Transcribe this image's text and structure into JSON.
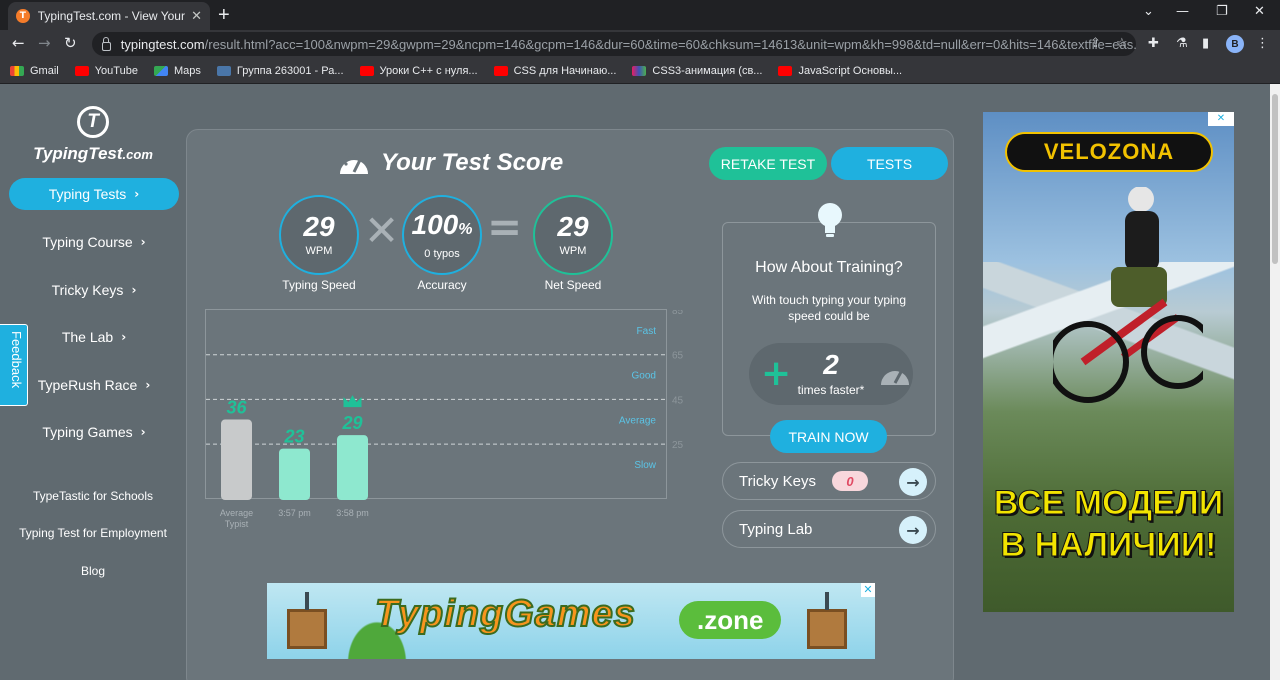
{
  "browser": {
    "tab_title": "TypingTest.com - View Your Typing Test Result",
    "url_host": "typingtest.com",
    "url_path": "/result.html?acc=100&nwpm=29&gwpm=29&ncpm=146&gcpm=146&dur=60&time=60&chksum=14613&unit=wpm&kh=998&td=null&err=0&hits=146&textfile=eas...",
    "profile_initial": "B",
    "bookmarks": [
      {
        "label": "Gmail",
        "icon": "gmail-icon"
      },
      {
        "label": "YouTube",
        "icon": "youtube-icon"
      },
      {
        "label": "Maps",
        "icon": "maps-icon"
      },
      {
        "label": "Группа 263001 - Ра...",
        "icon": "vk-icon"
      },
      {
        "label": "Уроки С++ с нуля...",
        "icon": "youtube-icon"
      },
      {
        "label": "CSS для Начинаю...",
        "icon": "youtube-icon"
      },
      {
        "label": "CSS3-анимация (св...",
        "icon": "css-icon"
      },
      {
        "label": "JavaScript Основы...",
        "icon": "youtube-icon"
      }
    ]
  },
  "sidebar": {
    "logo_text": "TypingTest",
    "logo_suffix": ".com",
    "logo_letter": "T",
    "nav": [
      {
        "label": "Typing Tests",
        "active": true
      },
      {
        "label": "Typing Course"
      },
      {
        "label": "Tricky Keys"
      },
      {
        "label": "The Lab"
      },
      {
        "label": "TypeRush Race"
      },
      {
        "label": "Typing Games"
      }
    ],
    "links": [
      "TypeTastic for Schools",
      "Typing Test for Employment",
      "Blog"
    ],
    "feedback": "Feedback"
  },
  "result": {
    "title": "Your Test Score",
    "retake_label": "RETAKE TEST",
    "tests_label": "TESTS",
    "typing_speed": {
      "value": "29",
      "unit": "WPM",
      "caption": "Typing Speed"
    },
    "accuracy": {
      "value": "100",
      "percent": "%",
      "sub": "0  typos",
      "caption": "Accuracy"
    },
    "net_speed": {
      "value": "29",
      "unit": "WPM",
      "caption": "Net Speed"
    },
    "operators": {
      "times": "✕",
      "equals": "="
    }
  },
  "chart_data": {
    "type": "bar",
    "categories": [
      "Average Typist",
      "3:57 pm",
      "3:58 pm"
    ],
    "values": [
      36,
      23,
      29
    ],
    "value_labels": [
      "36",
      "23",
      "29"
    ],
    "best_index": 2,
    "bar_colors": [
      "#c8cacb",
      "#8ee8cf",
      "#8ee8cf"
    ],
    "label_colors": [
      "#1fc198",
      "#1fc198",
      "#1fc198"
    ],
    "ylim": [
      0,
      85
    ],
    "level_lines": [
      {
        "value": 85,
        "tick": "85",
        "label": "Fast"
      },
      {
        "value": 65,
        "tick": "65",
        "label": "Good"
      },
      {
        "value": 45,
        "tick": "45",
        "label": "Average"
      },
      {
        "value": 25,
        "tick": "25",
        "label": "Slow"
      }
    ],
    "grid": true
  },
  "training": {
    "title": "How About Training?",
    "text": "With touch typing your typing speed could be",
    "multiplier": "2",
    "multiplier_label": "times faster*",
    "button": "TRAIN NOW"
  },
  "links": {
    "tricky_keys": {
      "label": "Tricky Keys",
      "count": "0"
    },
    "typing_lab": {
      "label": "Typing Lab"
    }
  },
  "banner_ad": {
    "brand": "TypingGames",
    "suffix": ".zone",
    "close": "✕"
  },
  "side_ad": {
    "brand": "VELOZONA",
    "tagline_1": "ВСЕ МОДЕЛИ",
    "tagline_2": "В НАЛИЧИИ!",
    "close": "✕"
  }
}
